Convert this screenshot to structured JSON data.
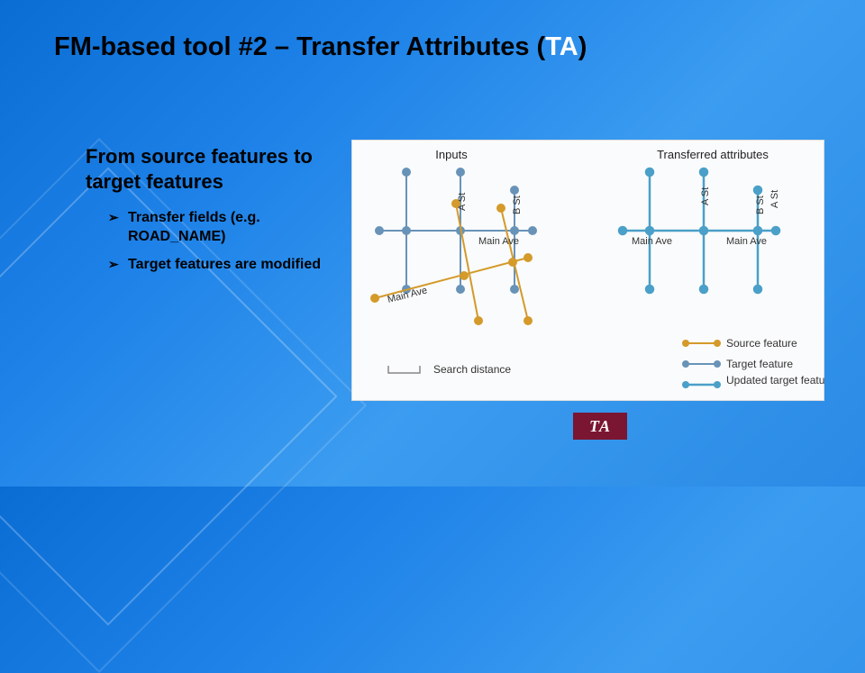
{
  "title": {
    "prefix": "FM-based tool #2 – Transfer Attributes (",
    "abbr": "TA",
    "suffix": ")"
  },
  "subtitle": "From source features to target features",
  "bullets": [
    "Transfer fields (e.g. ROAD_NAME)",
    "Target features are modified"
  ],
  "diagram": {
    "left_title": "Inputs",
    "right_title": "Transferred attributes",
    "labels": {
      "a_st": "A St",
      "b_st": "B St",
      "main_ave": "Main Ave"
    },
    "legend": {
      "search_distance": "Search distance",
      "source": "Source feature",
      "target": "Target feature",
      "updated": "Updated target feature"
    },
    "colors": {
      "source": "#d49a2a",
      "target": "#6893b8",
      "updated": "#4aa0c8"
    }
  },
  "tag": "TA"
}
